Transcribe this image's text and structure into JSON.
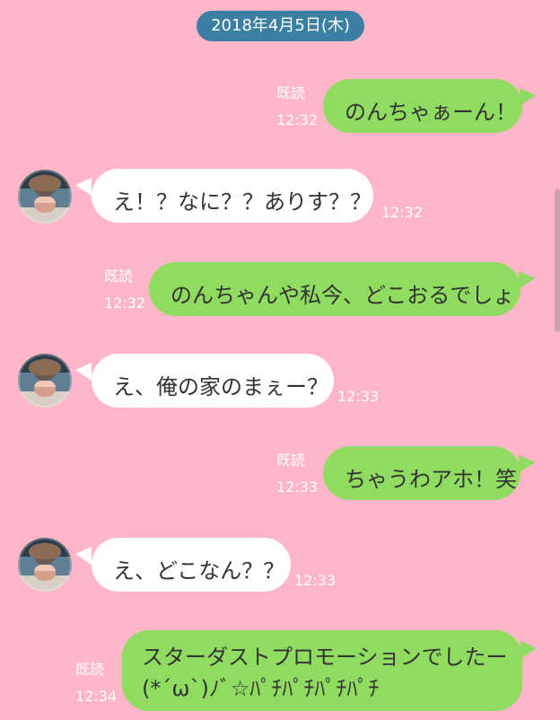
{
  "date_label": "2018年4月5日(木)",
  "messages": [
    {
      "direction": "sent",
      "text": "のんちゃぁーん！",
      "read": "既読",
      "time": "12:32"
    },
    {
      "direction": "received",
      "text": "え！？なに？？ありす？？",
      "time": "12:32"
    },
    {
      "direction": "sent",
      "text": "のんちゃんや私今、どこおるでしょ",
      "read": "既読",
      "time": "12:32"
    },
    {
      "direction": "received",
      "text": "え、俺の家のまぇー？",
      "time": "12:33"
    },
    {
      "direction": "sent",
      "text": "ちゃうわアホ！笑",
      "read": "既読",
      "time": "12:33"
    },
    {
      "direction": "received",
      "text": "え、どこなん？？",
      "time": "12:33"
    },
    {
      "direction": "sent",
      "text_line1": "スターダストプロモーションでしたー",
      "text_line2": "(*´ω`)ﾉﾞ☆ﾊﾟﾁﾊﾟﾁﾊﾟﾁﾊﾟﾁ",
      "read": "既読",
      "time": "12:34"
    }
  ],
  "colors": {
    "background": "#ffb6c8",
    "sent_bubble": "#8fdc60",
    "received_bubble": "#ffffff",
    "date_pill": "#3b80a2",
    "meta_text": "#ffffff"
  }
}
